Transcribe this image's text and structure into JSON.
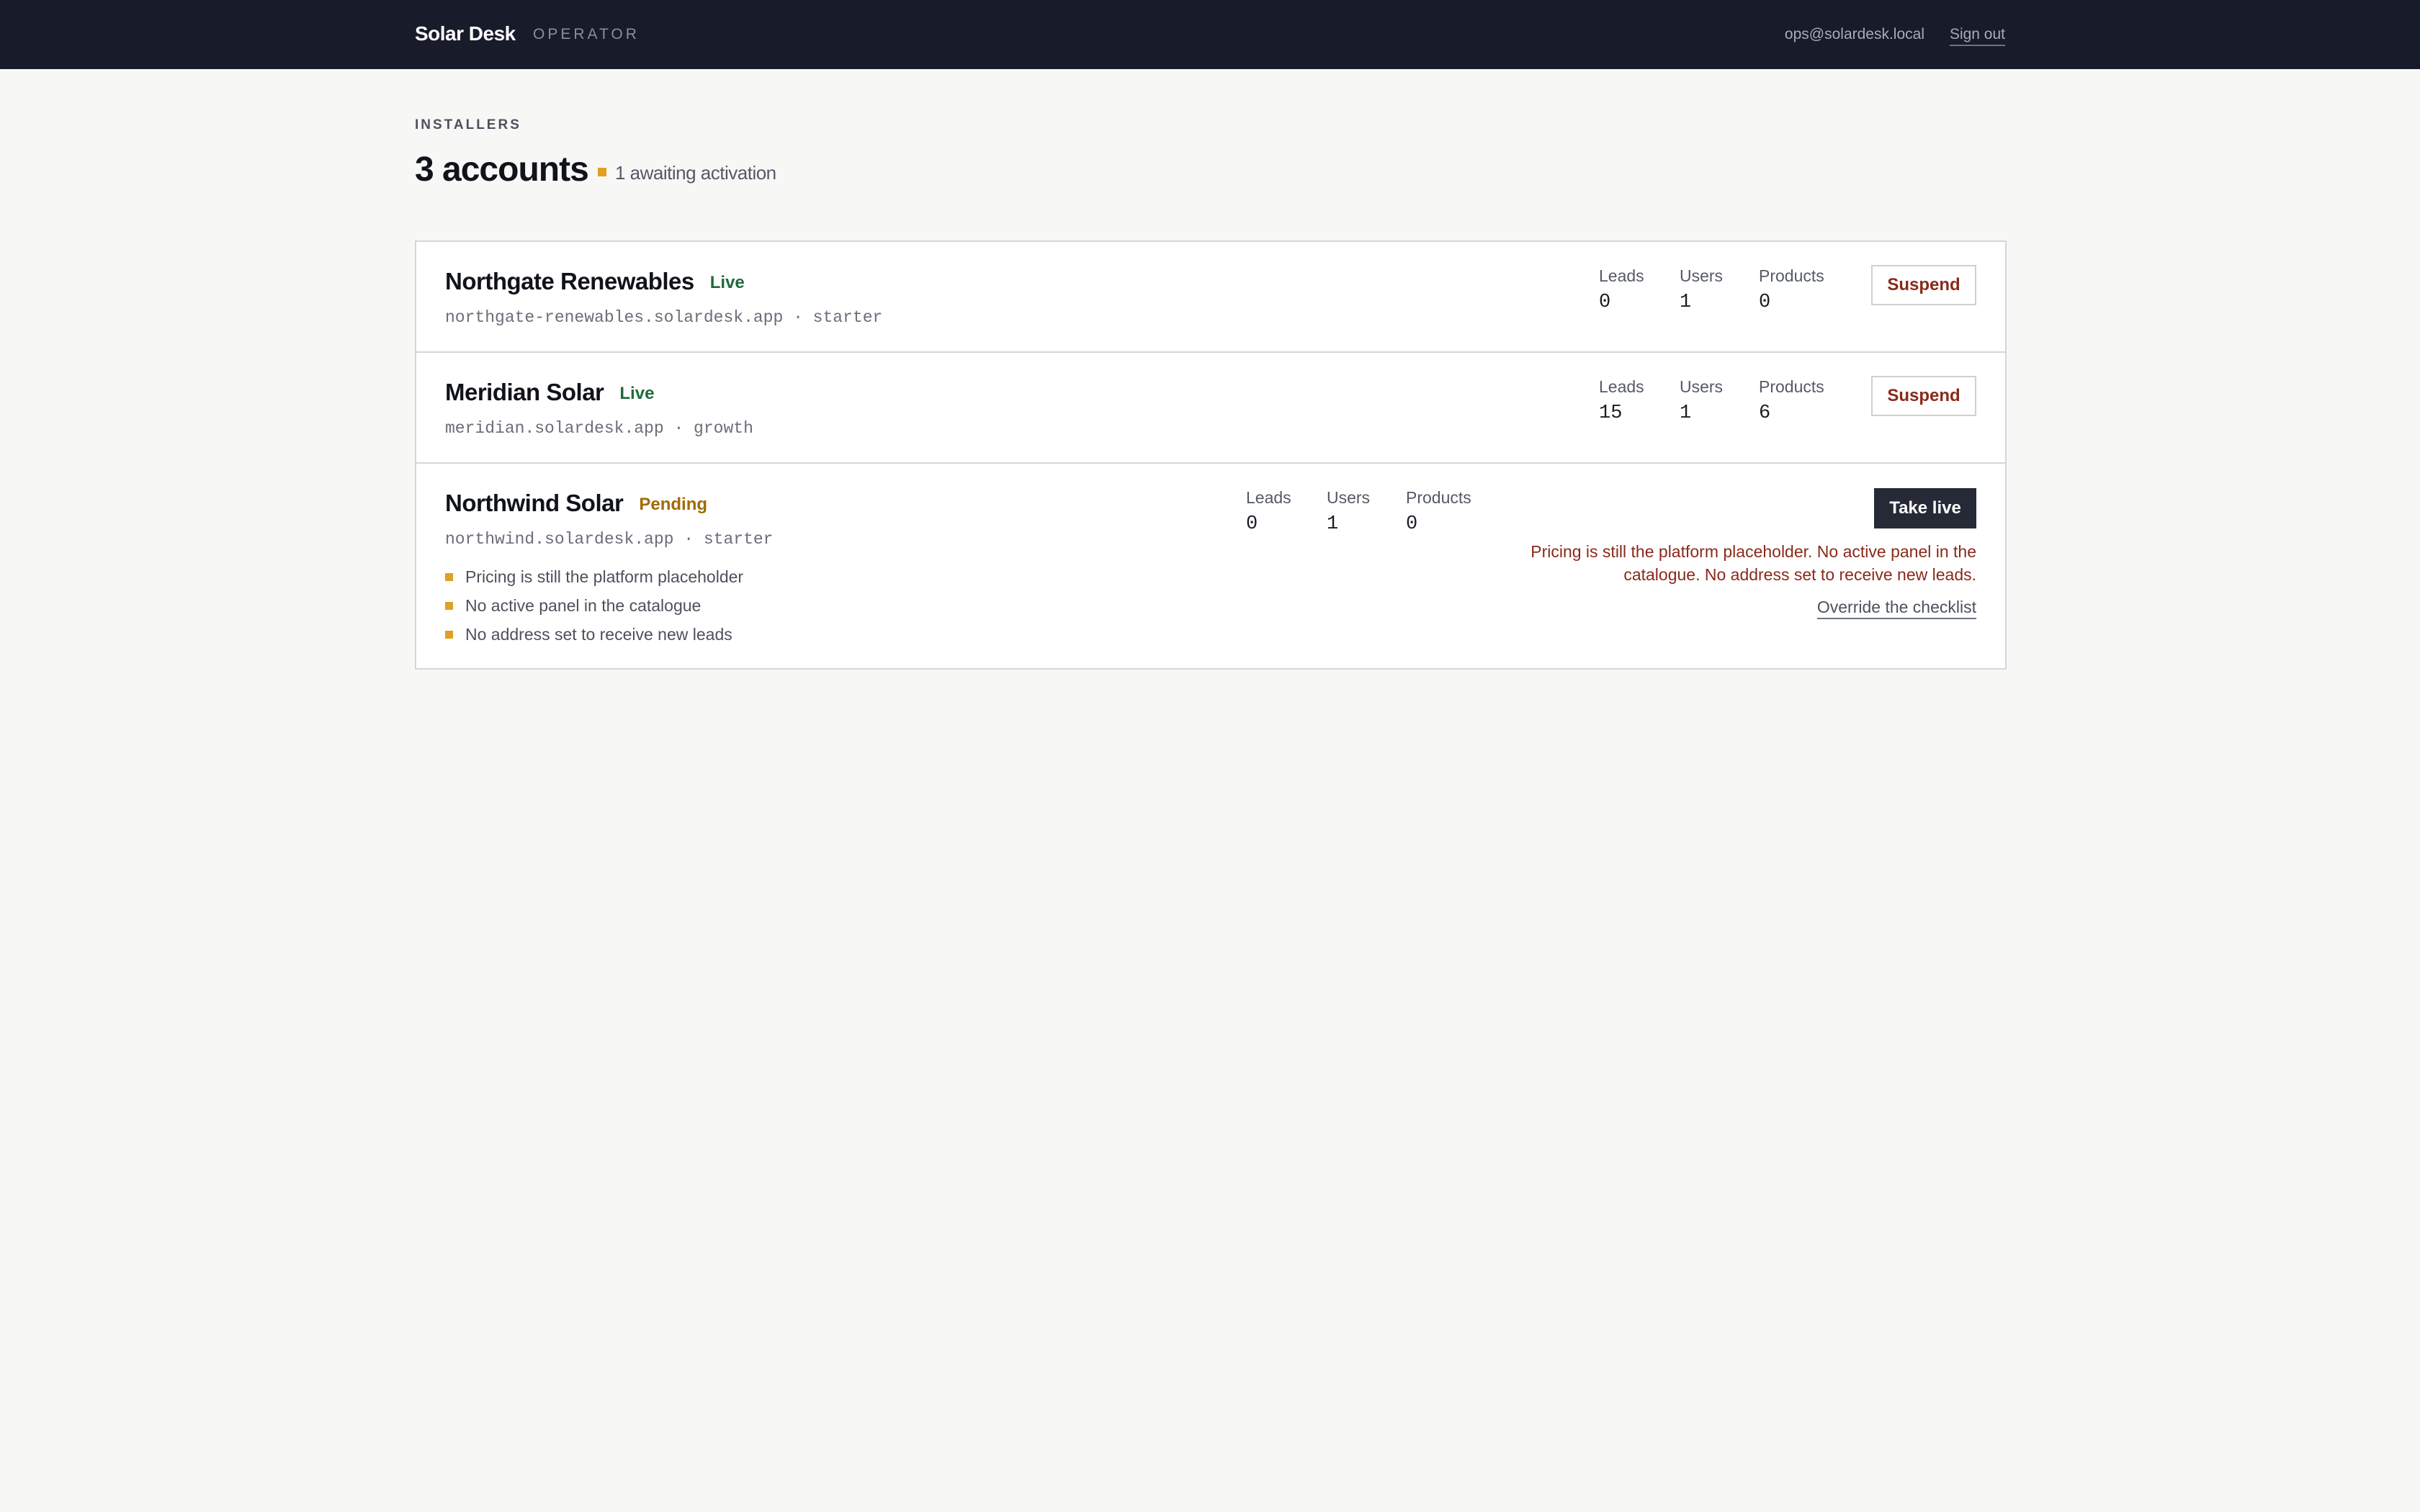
{
  "header": {
    "brand": "Solar Desk",
    "section": "OPERATOR",
    "user_email": "ops@solardesk.local",
    "signout_label": "Sign out"
  },
  "page": {
    "eyebrow": "INSTALLERS",
    "title": "3 accounts",
    "pending_note": "1 awaiting activation"
  },
  "colors": {
    "topbar": "#181b2a",
    "live": "#1f6b3b",
    "pending": "#a26a00",
    "warning_square": "#e0a020",
    "danger": "#8a2a1a",
    "primary_button": "#262a37"
  },
  "accounts": [
    {
      "name": "Northgate Renewables",
      "status": "Live",
      "meta": "northgate-renewables.solardesk.app · starter",
      "stats": {
        "leads_label": "Leads",
        "leads": "0",
        "users_label": "Users",
        "users": "1",
        "products_label": "Products",
        "products": "0"
      },
      "action_label": "Suspend"
    },
    {
      "name": "Meridian Solar",
      "status": "Live",
      "meta": "meridian.solardesk.app · growth",
      "stats": {
        "leads_label": "Leads",
        "leads": "15",
        "users_label": "Users",
        "users": "1",
        "products_label": "Products",
        "products": "6"
      },
      "action_label": "Suspend"
    },
    {
      "name": "Northwind Solar",
      "status": "Pending",
      "meta": "northwind.solardesk.app · starter",
      "stats": {
        "leads_label": "Leads",
        "leads": "0",
        "users_label": "Users",
        "users": "1",
        "products_label": "Products",
        "products": "0"
      },
      "action_label": "Take live",
      "warning": "Pricing is still the platform placeholder. No active panel in the catalogue. No address set to receive new leads.",
      "override_label": "Override the checklist",
      "checklist": [
        "Pricing is still the platform placeholder",
        "No active panel in the catalogue",
        "No address set to receive new leads"
      ]
    }
  ]
}
